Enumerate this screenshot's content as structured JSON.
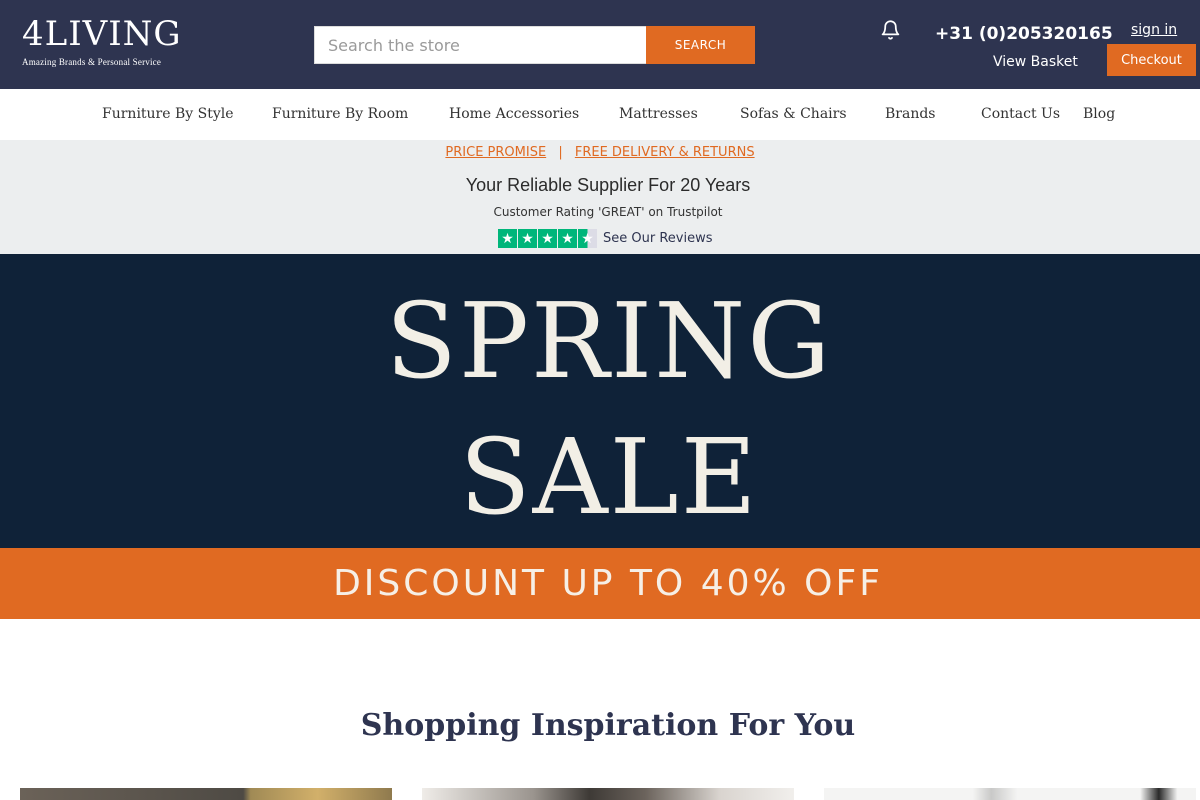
{
  "header": {
    "logo_main": "4LIVING",
    "logo_tagline": "Amazing Brands & Personal Service",
    "search_placeholder": "Search the store",
    "search_button": "SEARCH",
    "phone": "+31 (0)205320165",
    "view_basket": "View Basket",
    "sign_in": "sign in",
    "checkout": "Checkout"
  },
  "nav": {
    "items": [
      {
        "label": "Furniture By Style"
      },
      {
        "label": "Furniture By Room"
      },
      {
        "label": "Home Accessories"
      },
      {
        "label": "Mattresses"
      },
      {
        "label": "Sofas & Chairs"
      },
      {
        "label": "Brands"
      },
      {
        "label": "Contact Us"
      },
      {
        "label": "Blog"
      }
    ]
  },
  "info": {
    "price_promise": "PRICE PROMISE",
    "separator": "|",
    "free_delivery": "FREE DELIVERY & RETURNS",
    "supplier": "Your Reliable Supplier For 20 Years",
    "rating": "Customer Rating 'GREAT' on Trustpilot",
    "star_rating": 4.5,
    "star_max": 5,
    "see_reviews": "See Our Reviews"
  },
  "banner": {
    "line1": "SPRING",
    "line2": "SALE",
    "discount": "DISCOUNT UP TO 40% OFF"
  },
  "inspiration": {
    "title": "Shopping Inspiration For You"
  },
  "colors": {
    "header_bg": "#2e3450",
    "accent": "#e06a22",
    "banner_bg": "#0f2238",
    "info_bg": "#eceeef",
    "trustpilot_green": "#00b67a"
  }
}
